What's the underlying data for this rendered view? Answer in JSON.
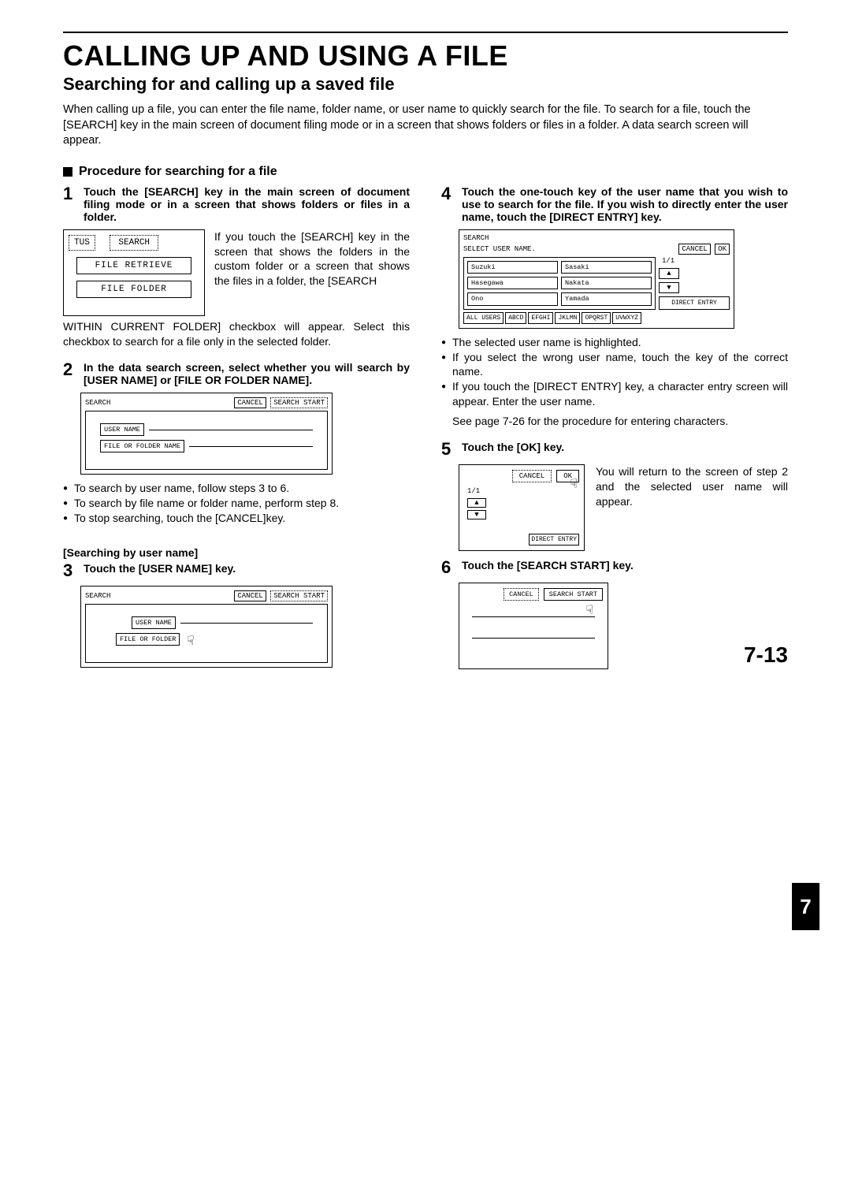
{
  "title": "CALLING UP AND USING A FILE",
  "subtitle": "Searching for and calling up a saved file",
  "intro": "When calling up a file, you can enter the file name, folder name, or user name to quickly search for the file. To search for a file, touch the [SEARCH] key in the main screen of document filing mode or in a screen that shows folders or files in a folder. A data search screen will appear.",
  "section_heading": "Procedure for searching for a file",
  "chapter_tab": "7",
  "page_number": "7-13",
  "step1": {
    "num": "1",
    "heading": "Touch the [SEARCH] key in the main screen of document filing mode or in a screen that shows folders or files in a folder.",
    "ui": {
      "tus": "TUS",
      "search": "SEARCH",
      "btn_retrieve": "FILE RETRIEVE",
      "btn_folder": "FILE FOLDER"
    },
    "para": "If you touch the [SEARCH] key in the screen that shows the folders in the custom folder or a screen that shows the files in a folder, the [SEARCH WITHIN CURRENT FOLDER] checkbox will appear. Select this checkbox to search for a file only in the selected folder."
  },
  "step2": {
    "num": "2",
    "heading": "In the data search screen, select whether you will search by [USER NAME] or [FILE OR FOLDER NAME].",
    "ui": {
      "title": "SEARCH",
      "cancel": "CANCEL",
      "search_start": "SEARCH START",
      "opt_user": "USER NAME",
      "opt_file": "FILE OR FOLDER NAME"
    },
    "bullets": [
      "To search by user name, follow steps 3 to 6.",
      "To search by file name or folder name, perform step 8.",
      "To stop searching, touch the [CANCEL]key."
    ]
  },
  "step3_group_label": "[Searching by user name]",
  "step3": {
    "num": "3",
    "heading": "Touch the [USER NAME] key.",
    "ui": {
      "title": "SEARCH",
      "cancel": "CANCEL",
      "search_start": "SEARCH START",
      "opt_user": "USER NAME",
      "opt_file": "FILE OR FOLDER"
    }
  },
  "step4": {
    "num": "4",
    "heading": "Touch the one-touch key of the user name that you wish to use to search for the file. If you wish to directly enter the user name, touch the [DIRECT ENTRY] key.",
    "ui": {
      "title": "SEARCH",
      "subtitle": "SELECT USER NAME.",
      "cancel": "CANCEL",
      "ok": "OK",
      "page": "1/1",
      "direct_entry": "DIRECT ENTRY",
      "users": [
        "Suzuki",
        "Sasaki",
        "Hasegawa",
        "Nakata",
        "Ono",
        "Yamada"
      ],
      "tabs": [
        "ALL USERS",
        "ABCD",
        "EFGHI",
        "JKLMN",
        "OPQRST",
        "UVWXYZ"
      ]
    },
    "bullets": [
      "The selected user name is highlighted.",
      "If you select the wrong user name, touch the key of the correct name.",
      "If you touch the [DIRECT ENTRY] key, a character entry screen will appear. Enter the user name."
    ],
    "note": "See page 7-26 for the procedure for entering characters."
  },
  "step5": {
    "num": "5",
    "heading": "Touch the [OK] key.",
    "ui": {
      "cancel": "CANCEL",
      "ok": "OK",
      "page": "1/1",
      "direct_entry": "DIRECT ENTRY"
    },
    "para": "You will return to the screen of step 2 and the selected user name will appear."
  },
  "step6": {
    "num": "6",
    "heading": "Touch the [SEARCH START] key.",
    "ui": {
      "cancel": "CANCEL",
      "search_start": "SEARCH START"
    }
  }
}
